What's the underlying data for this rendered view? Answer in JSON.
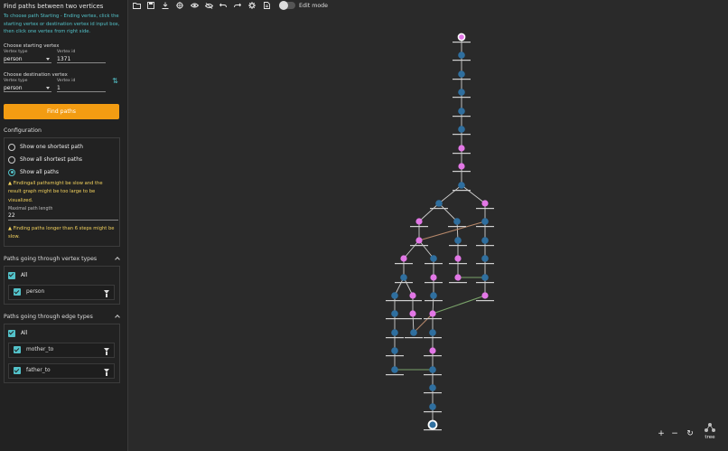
{
  "sidebar": {
    "title": "Find paths between two vertices",
    "help": "To choose path Starting - Ending vertex, click the starting vertex or destination vertex id input box, then click one vertex from right side.",
    "start": {
      "label": "Choose starting vertex",
      "type_label": "Vertex type",
      "type_value": "person",
      "id_label": "Vertex id",
      "id_value": "1371"
    },
    "dest": {
      "label": "Choose destination vertex",
      "type_label": "Vertex type",
      "type_value": "person",
      "id_label": "Vertex id",
      "id_value": "1"
    },
    "find_button": "Find paths",
    "configuration": {
      "title": "Configuration",
      "options": [
        "Show one shortest path",
        "Show all shortest paths",
        "Show all paths"
      ],
      "selected_index": 2,
      "warning1": "Findingall pathsmight be slow and the result graph might be too large to be visualized.",
      "max_label": "Maximal path length",
      "max_value": "22",
      "warning2": "Finding paths longer than 6 steps might be slow."
    },
    "vertex_types": {
      "title": "Paths going through vertex types",
      "all_label": "All",
      "items": [
        "person"
      ]
    },
    "edge_types": {
      "title": "Paths going through edge types",
      "all_label": "All",
      "items": [
        "mother_to",
        "father_to"
      ]
    }
  },
  "toolbar": {
    "icons": [
      "folder-icon",
      "save-icon",
      "download-icon",
      "target-icon",
      "eye-icon",
      "eye-off-icon",
      "undo-icon",
      "redo-icon",
      "settings-icon",
      "document-icon"
    ],
    "edit_mode_label": "Edit mode",
    "edit_mode_on": false
  },
  "graph_controls": {
    "zoom_in": "+",
    "zoom_out": "−",
    "reset": "↻",
    "layout_label": "tree"
  },
  "colors": {
    "accent": "#53c2c9",
    "button": "#f39c12",
    "node_male": "#2f6f9f",
    "node_female": "#e277e6",
    "edge_mother": "#b5876a",
    "edge_father": "#7aa36a",
    "warning": "#f4d35e"
  }
}
